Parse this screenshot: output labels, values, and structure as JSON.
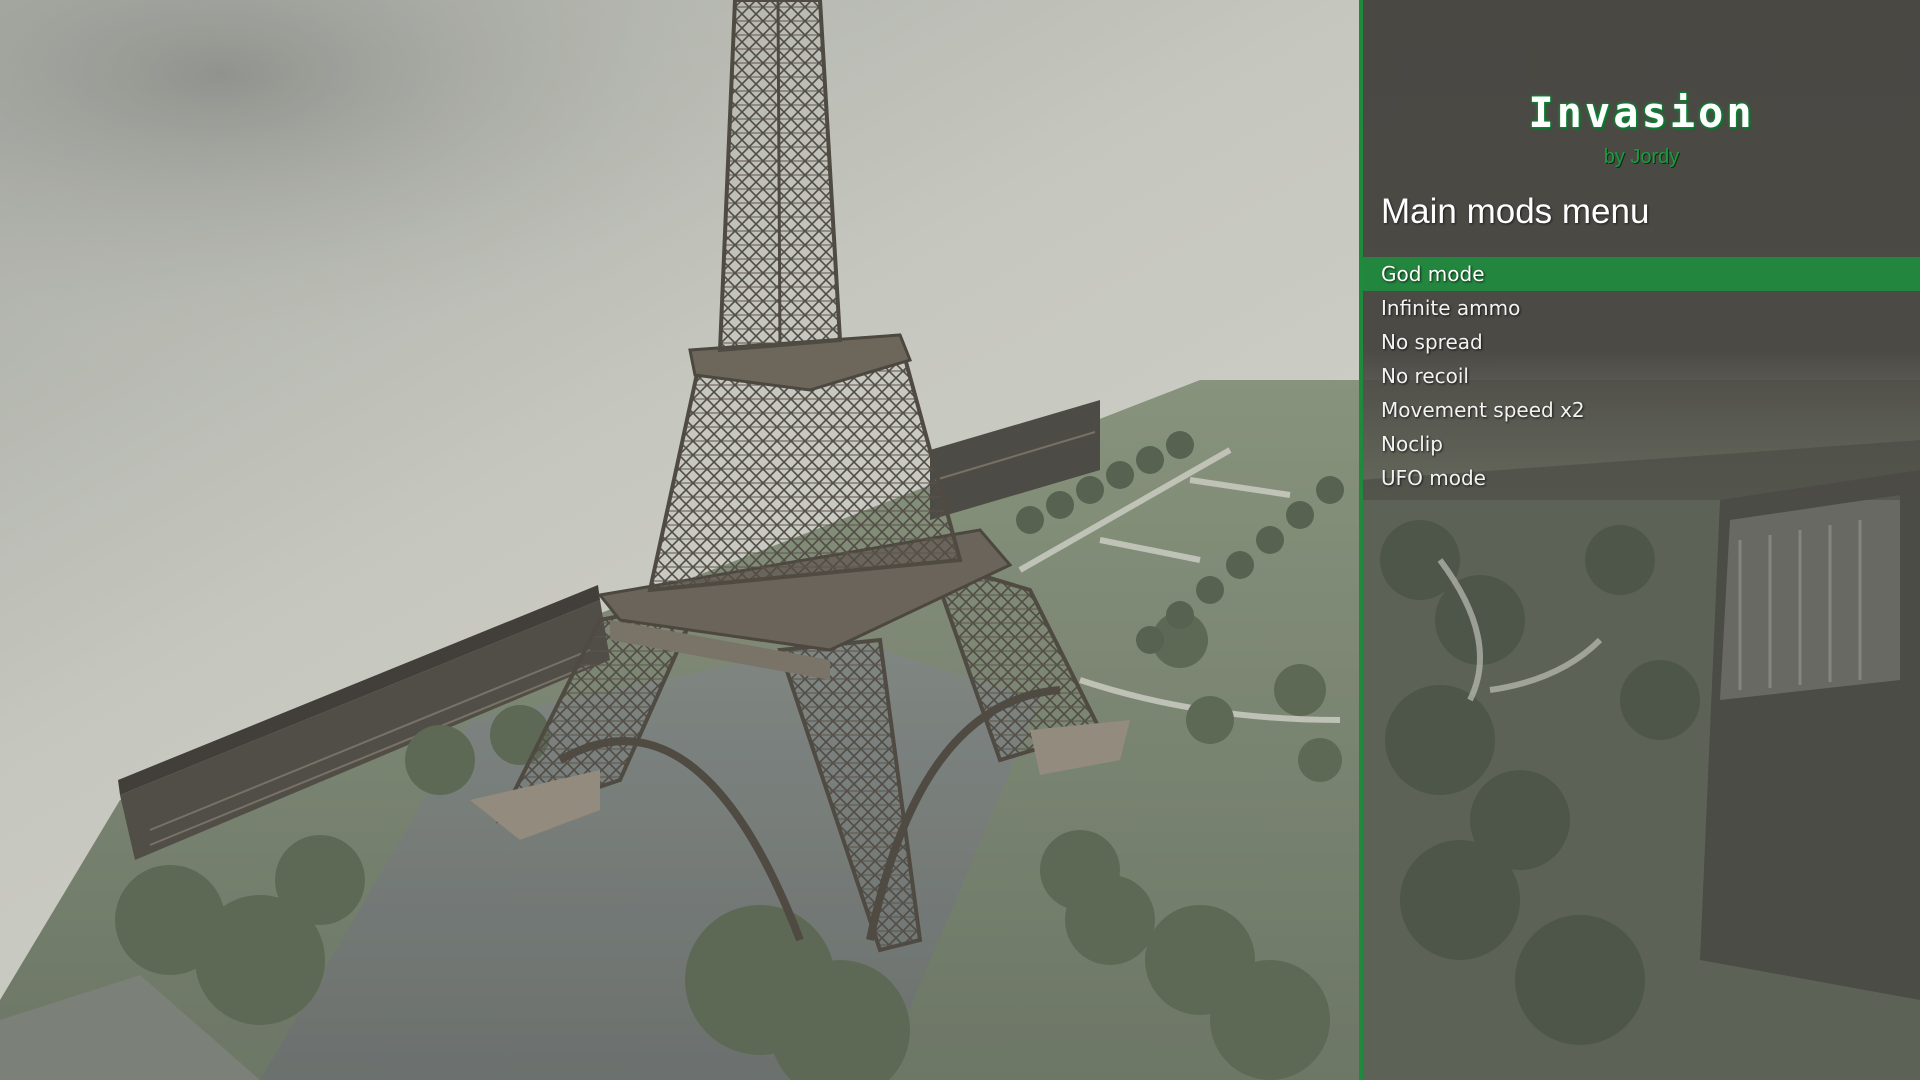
{
  "menu": {
    "title": "Invasion",
    "author": "by Jordy",
    "heading": "Main mods menu",
    "selected_index": 0,
    "items": [
      {
        "label": "God mode"
      },
      {
        "label": "Infinite ammo"
      },
      {
        "label": "No spread"
      },
      {
        "label": "No recoil"
      },
      {
        "label": "Movement speed x2"
      },
      {
        "label": "Noclip"
      },
      {
        "label": "UFO mode"
      }
    ],
    "colors": {
      "accent": "#23863f",
      "border": "#1f8a3c",
      "author_text": "#1a9b3f",
      "panel_bg": "#4a4843"
    }
  },
  "scene": {
    "description_icons": [
      "eiffel-tower",
      "trees",
      "buildings",
      "sky"
    ]
  }
}
